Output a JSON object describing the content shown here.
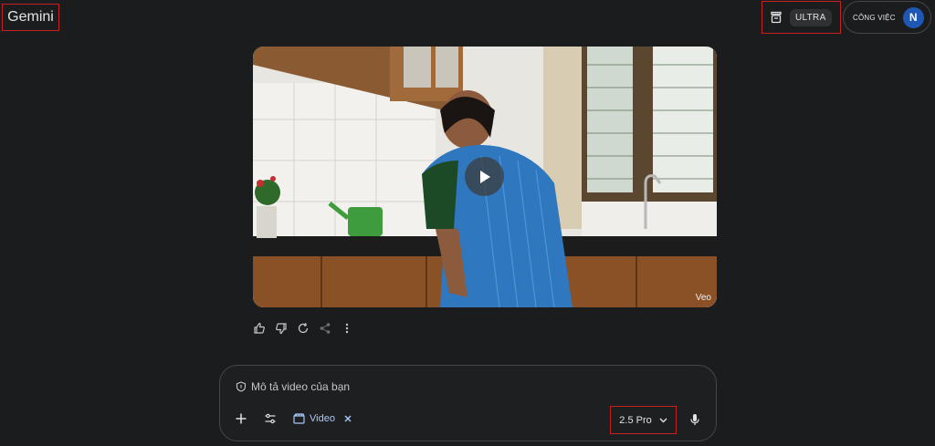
{
  "header": {
    "app_title": "Gemini",
    "plan_badge": "ULTRA",
    "account_label": "CÔNG VIỆC",
    "avatar_initial": "N"
  },
  "video": {
    "watermark": "Veo"
  },
  "actions": [
    "thumb-up-icon",
    "thumb-down-icon",
    "refresh-icon",
    "share-icon",
    "more-vert-icon"
  ],
  "composer": {
    "placeholder": "Mô tả video của bạn",
    "tool_chip_label": "Video",
    "model_label": "2.5 Pro"
  },
  "colors": {
    "background": "#1b1c1d",
    "highlight_border": "#c5221f",
    "chip_blue": "#a8c7fa",
    "avatar_blue": "#1f57b5"
  }
}
